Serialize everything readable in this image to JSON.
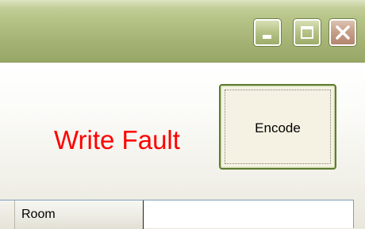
{
  "window": {
    "controls": {
      "minimize_icon": "minimize-icon",
      "maximize_icon": "maximize-icon",
      "close_icon": "close-icon"
    }
  },
  "status": {
    "text": "Write Fault",
    "color": "#ff0000"
  },
  "encode_button": {
    "label": "Encode"
  },
  "grid": {
    "columns": [
      {
        "label": "Room"
      }
    ]
  }
}
